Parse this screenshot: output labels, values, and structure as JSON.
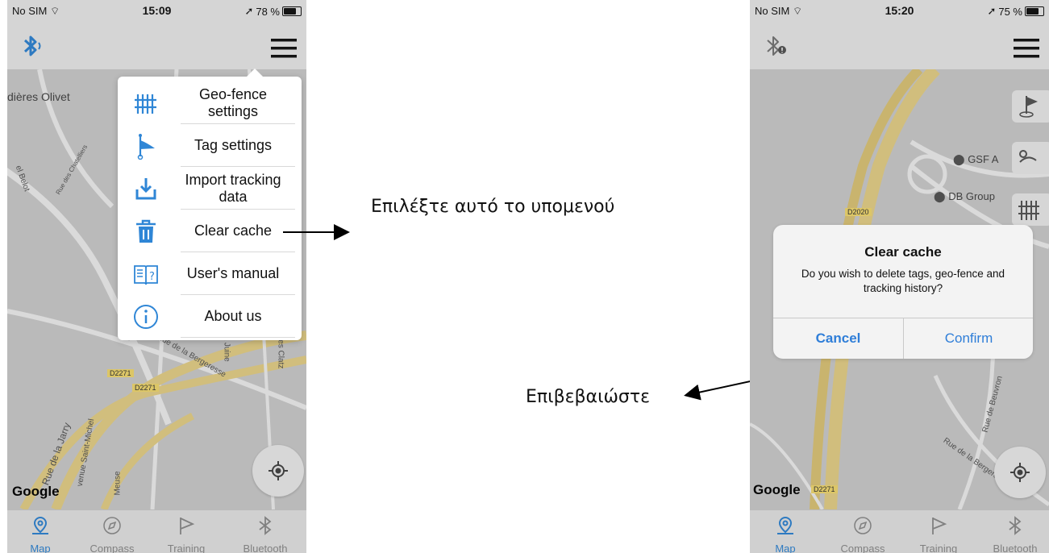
{
  "left_phone": {
    "status": {
      "carrier": "No SIM",
      "time": "15:09",
      "battery": "78 %"
    },
    "map": {
      "place_label": "dières Olivet",
      "road_labels": [
        "D2271",
        "D2271"
      ],
      "street_labels": [
        "Rue des Chatelliers",
        "el Belot",
        "Rue de la Bergeresse",
        "Rue de la Jarry",
        "venue Saint-Michel",
        "la Juine",
        "des Clatz",
        "Rue de",
        "Meuse"
      ],
      "google": "Google"
    },
    "menu": [
      {
        "label": "Geo-fence settings",
        "icon": "fence-icon"
      },
      {
        "label": "Tag settings",
        "icon": "flag-tag-icon"
      },
      {
        "label": "Import tracking data",
        "icon": "download-icon"
      },
      {
        "label": "Clear cache",
        "icon": "trash-icon"
      },
      {
        "label": "User's manual",
        "icon": "manual-icon"
      },
      {
        "label": "About us",
        "icon": "info-icon"
      }
    ]
  },
  "right_phone": {
    "status": {
      "carrier": "No SIM",
      "time": "15:20",
      "battery": "75 %"
    },
    "map": {
      "places": [
        "GSF A",
        "DB Group"
      ],
      "road_labels": [
        "D2020",
        "D2271"
      ],
      "street_labels": [
        "Rue de Beuvron",
        "Rue de la Bergeresse"
      ],
      "google": "Google"
    },
    "alert": {
      "title": "Clear cache",
      "message": "Do you wish to delete tags, geo-fence and tracking history?",
      "cancel": "Cancel",
      "confirm": "Confirm"
    }
  },
  "tabs": [
    {
      "label": "Map",
      "icon": "map-pin-icon"
    },
    {
      "label": "Compass",
      "icon": "compass-icon"
    },
    {
      "label": "Training",
      "icon": "flag-icon"
    },
    {
      "label": "Bluetooth",
      "icon": "bluetooth-icon"
    }
  ],
  "annotations": {
    "select_submenu": "Επιλέξτε αυτό το υπομενού",
    "confirm": "Επιβεβαιώστε"
  },
  "colors": {
    "accent": "#2f86d6",
    "road_major": "#e9d389",
    "map_bg": "#d3d3d3",
    "alert_button": "#2f7ed8"
  }
}
